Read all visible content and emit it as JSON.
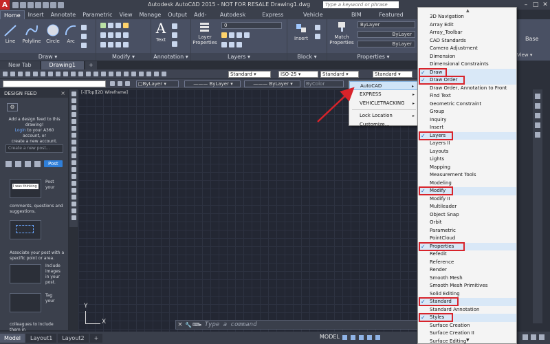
{
  "app": {
    "title": "Autodesk AutoCAD 2015 - NOT FOR RESALE   Drawing1.dwg",
    "logo_letter": "A",
    "search_placeholder": "Type a keyword or phrase"
  },
  "ribbon": {
    "tabs": [
      {
        "label": "Home",
        "active": true
      },
      {
        "label": "Insert"
      },
      {
        "label": "Annotate"
      },
      {
        "label": "Parametric"
      },
      {
        "label": "View"
      },
      {
        "label": "Manage"
      },
      {
        "label": "Output"
      },
      {
        "label": "Add-ins"
      },
      {
        "label": "Autodesk 360"
      },
      {
        "label": "Express Tools"
      },
      {
        "label": "Vehicle Tracking"
      },
      {
        "label": "BIM 360"
      },
      {
        "label": "Featured Apps"
      }
    ],
    "draw_tools": [
      "Line",
      "Polyline",
      "Circle",
      "Arc"
    ],
    "text_tool": "Text",
    "layer_tool": "Layer Properties",
    "insert_tool": "Insert",
    "match_tool": "Match Properties",
    "panels": {
      "draw": "Draw ▾",
      "modify": "Modify ▾",
      "annotation": "Annotation ▾",
      "layers": "Layers ▾",
      "block": "Block ▾",
      "properties": "Properties ▾"
    },
    "bylayer_1": "ByLayer",
    "bylayer_2": "ByLayer",
    "bylayer_3": "ByLayer",
    "layer_combo": "0",
    "base_label": "Base",
    "view_label": "View ▾"
  },
  "file_tabs": [
    {
      "label": "New Tab"
    },
    {
      "label": "Drawing1",
      "active": true
    },
    {
      "label": "+"
    }
  ],
  "toolbar": {
    "text_style": "Standard",
    "dim_style": "ISO-25",
    "table_style": "Standard",
    "mleader_style": "Standard",
    "layer": "ByLayer",
    "linetype": "ByLayer",
    "lineweight": "ByLayer",
    "plot_color": "ByColor"
  },
  "design_feed": {
    "title": "DESIGN FEED",
    "close": "×",
    "gear": "⚙",
    "intro_line1": "Add a design feed to this",
    "intro_line2": "drawing!",
    "intro_link": "Login",
    "intro_line3": "to your A360 account, or",
    "intro_line4": "create a new account.",
    "input_placeholder": "Create a new post...",
    "post_button": "Post",
    "thumb1_caption": "I was thinking",
    "side1_line1": "Post",
    "side1_line2": "your",
    "para1_line1": "comments, questions and",
    "para1_line2": "suggestions.",
    "para2_line1": "Associate your post with a",
    "para2_line2": "specific point or area.",
    "side2_line1": "Include",
    "side2_line2": "images",
    "side2_line3": "in your",
    "side2_line4": "post.",
    "side3_line1": "Tag",
    "side3_line2": "your",
    "para3_line1": "colleagues to include them in"
  },
  "viewport_label": "[-][Top][2D Wireframe]",
  "ucs": {
    "x": "X",
    "y": "Y"
  },
  "command": {
    "close": "×",
    "prompt": "⌨▸",
    "placeholder": "Type a command"
  },
  "status": {
    "layout_tabs": [
      {
        "label": "Model",
        "active": true
      },
      {
        "label": "Layout1"
      },
      {
        "label": "Layout2"
      },
      {
        "label": "+"
      }
    ],
    "model_button": "MODEL"
  },
  "submenu": {
    "items": [
      {
        "label": "AutoCAD",
        "arrow": "▸",
        "highlighted": true
      },
      {
        "label": "EXPRESS",
        "arrow": "▸"
      },
      {
        "label": "VEHICLETRACKING",
        "arrow": "▸"
      },
      {
        "sep": true
      },
      {
        "label": "Lock Location",
        "arrow": "▸"
      },
      {
        "label": "Customize..."
      }
    ]
  },
  "toolbar_menu": {
    "scroll_up": "▲",
    "scroll_down": "▼",
    "items": [
      {
        "label": "3D Navigation"
      },
      {
        "label": "Array Edit"
      },
      {
        "label": "Array_Toolbar"
      },
      {
        "label": "CAD Standards"
      },
      {
        "label": "Camera Adjustment"
      },
      {
        "label": "Dimension"
      },
      {
        "label": "Dimensional Constraints"
      },
      {
        "label": "Draw",
        "checked": true,
        "boxed": true
      },
      {
        "label": "Draw Order",
        "checked": true,
        "boxed": true
      },
      {
        "label": "Draw Order, Annotation to Front"
      },
      {
        "label": "Find Text"
      },
      {
        "label": "Geometric Constraint"
      },
      {
        "label": "Group"
      },
      {
        "label": "Inquiry"
      },
      {
        "label": "Insert"
      },
      {
        "label": "Layers",
        "checked": true,
        "boxed": true
      },
      {
        "label": "Layers II"
      },
      {
        "label": "Layouts"
      },
      {
        "label": "Lights"
      },
      {
        "label": "Mapping"
      },
      {
        "label": "Measurement Tools"
      },
      {
        "label": "Modeling"
      },
      {
        "label": "Modify",
        "checked": true,
        "boxed": true
      },
      {
        "label": "Modify II"
      },
      {
        "label": "Multileader"
      },
      {
        "label": "Object Snap"
      },
      {
        "label": "Orbit"
      },
      {
        "label": "Parametric"
      },
      {
        "label": "PointCloud"
      },
      {
        "label": "Properties",
        "checked": true,
        "boxed": true
      },
      {
        "label": "Refedit"
      },
      {
        "label": "Reference"
      },
      {
        "label": "Render"
      },
      {
        "label": "Smooth Mesh"
      },
      {
        "label": "Smooth Mesh Primitives"
      },
      {
        "label": "Solid Editing"
      },
      {
        "label": "Standard",
        "checked": true,
        "boxed": true
      },
      {
        "label": "Standard Annotation"
      },
      {
        "label": "Styles",
        "checked": true,
        "boxed": true
      },
      {
        "label": "Surface Creation"
      },
      {
        "label": "Surface Creation II"
      },
      {
        "label": "Surface Editing"
      }
    ]
  },
  "colors": {
    "accent_red": "#d8232a",
    "check_blue": "#1a5fb4",
    "post_blue": "#2f7fd9"
  }
}
